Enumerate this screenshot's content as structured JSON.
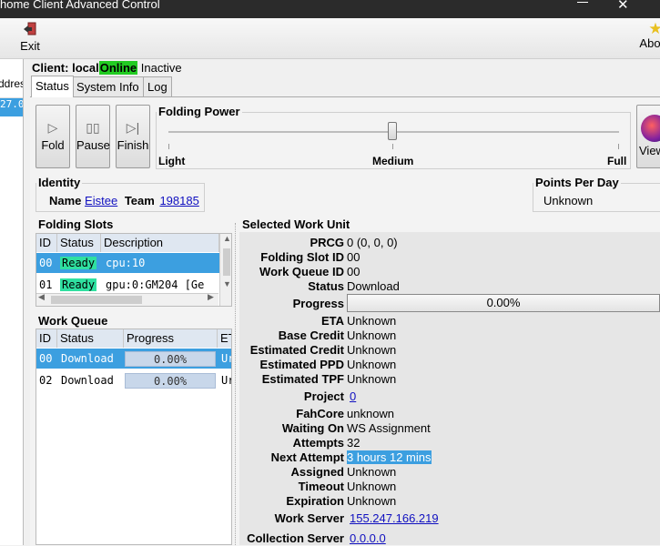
{
  "window": {
    "title": "home Client Advanced Control"
  },
  "toolbar": {
    "exit_label": "Exit",
    "about_label": "Abo"
  },
  "left": {
    "header": "ddres",
    "selected": "27.0"
  },
  "client": {
    "prefix": "Client:",
    "name": "local",
    "status": "Online",
    "state": "Inactive"
  },
  "tabs": [
    "Status",
    "System Info",
    "Log"
  ],
  "controls": {
    "fold": "Fold",
    "pause": "Pause",
    "finish": "Finish",
    "viewer": "View"
  },
  "folding_power": {
    "title": "Folding Power",
    "low": "Light",
    "mid": "Medium",
    "high": "Full",
    "level": 0.5
  },
  "identity": {
    "title": "Identity",
    "name_label": "Name",
    "name": "Eistee",
    "team_label": "Team",
    "team": "198185"
  },
  "ppd": {
    "title": "Points Per Day",
    "value": "Unknown"
  },
  "folding_slots": {
    "title": "Folding Slots",
    "columns": [
      "ID",
      "Status",
      "Description"
    ],
    "rows": [
      {
        "id": "00",
        "status": "Ready",
        "description": "cpu:10"
      },
      {
        "id": "01",
        "status": "Ready",
        "description": "gpu:0:GM204 [Ge"
      }
    ]
  },
  "work_queue": {
    "title": "Work Queue",
    "columns": [
      "ID",
      "Status",
      "Progress",
      "ET"
    ],
    "rows": [
      {
        "id": "00",
        "status": "Download",
        "progress": "0.00%",
        "eta": "Ur"
      },
      {
        "id": "02",
        "status": "Download",
        "progress": "0.00%",
        "eta": "Ur"
      }
    ]
  },
  "work_unit": {
    "title": "Selected Work Unit",
    "prcg_label": "PRCG",
    "prcg": "0 (0, 0, 0)",
    "slot_label": "Folding Slot ID",
    "slot": "00",
    "queue_label": "Work Queue ID",
    "queue": "00",
    "status_label": "Status",
    "status": "Download",
    "progress_label": "Progress",
    "progress": "0.00%",
    "eta_label": "ETA",
    "eta": "Unknown",
    "base_credit_label": "Base Credit",
    "base_credit": "Unknown",
    "est_credit_label": "Estimated Credit",
    "est_credit": "Unknown",
    "est_ppd_label": "Estimated PPD",
    "est_ppd": "Unknown",
    "est_tpf_label": "Estimated TPF",
    "est_tpf": "Unknown",
    "project_label": "Project",
    "project": "0",
    "fahcore_label": "FahCore",
    "fahcore": "unknown",
    "waiting_label": "Waiting On",
    "waiting": "WS Assignment",
    "attempts_label": "Attempts",
    "attempts": "32",
    "next_attempt_label": "Next Attempt",
    "next_attempt": "3 hours 12 mins",
    "assigned_label": "Assigned",
    "assigned": "Unknown",
    "timeout_label": "Timeout",
    "timeout": "Unknown",
    "expiration_label": "Expiration",
    "expiration": "Unknown",
    "work_server_label": "Work Server",
    "work_server": "155.247.166.219",
    "collection_server_label": "Collection Server",
    "collection_server": "0.0.0.0"
  },
  "colors": {
    "online": "#22cc22",
    "selection": "#3c9fe0",
    "ready": "#2fe0a0"
  }
}
